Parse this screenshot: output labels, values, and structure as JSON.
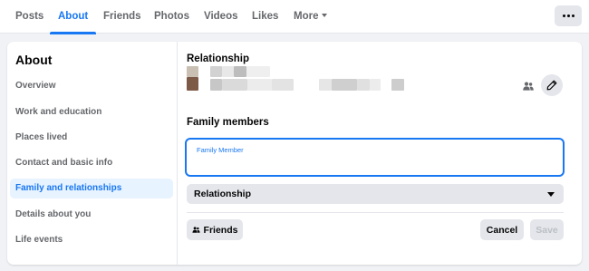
{
  "tabs": [
    {
      "label": "Posts",
      "active": false
    },
    {
      "label": "About",
      "active": true
    },
    {
      "label": "Friends",
      "active": false
    },
    {
      "label": "Photos",
      "active": false
    },
    {
      "label": "Videos",
      "active": false
    },
    {
      "label": "Likes",
      "active": false
    },
    {
      "label": "More",
      "active": false
    }
  ],
  "sidebar": {
    "title": "About",
    "items": [
      {
        "label": "Overview",
        "active": false
      },
      {
        "label": "Work and education",
        "active": false
      },
      {
        "label": "Places lived",
        "active": false
      },
      {
        "label": "Contact and basic info",
        "active": false
      },
      {
        "label": "Family and relationships",
        "active": true
      },
      {
        "label": "Details about you",
        "active": false
      },
      {
        "label": "Life events",
        "active": false
      }
    ]
  },
  "relationship": {
    "title": "Relationship"
  },
  "family": {
    "title": "Family members",
    "input_label": "Family Member",
    "input_value": "",
    "select_value": "Relationship"
  },
  "actions": {
    "audience_label": "Friends",
    "cancel_label": "Cancel",
    "save_label": "Save"
  },
  "colors": {
    "accent": "#1877f2",
    "active_bg": "#e7f3ff",
    "button_bg": "#e4e6eb",
    "page_bg": "#f0f2f5"
  },
  "icons": {
    "more": "more-dots-icon",
    "audience": "friends-icon",
    "edit": "pencil-icon",
    "select": "caret-down-icon"
  }
}
